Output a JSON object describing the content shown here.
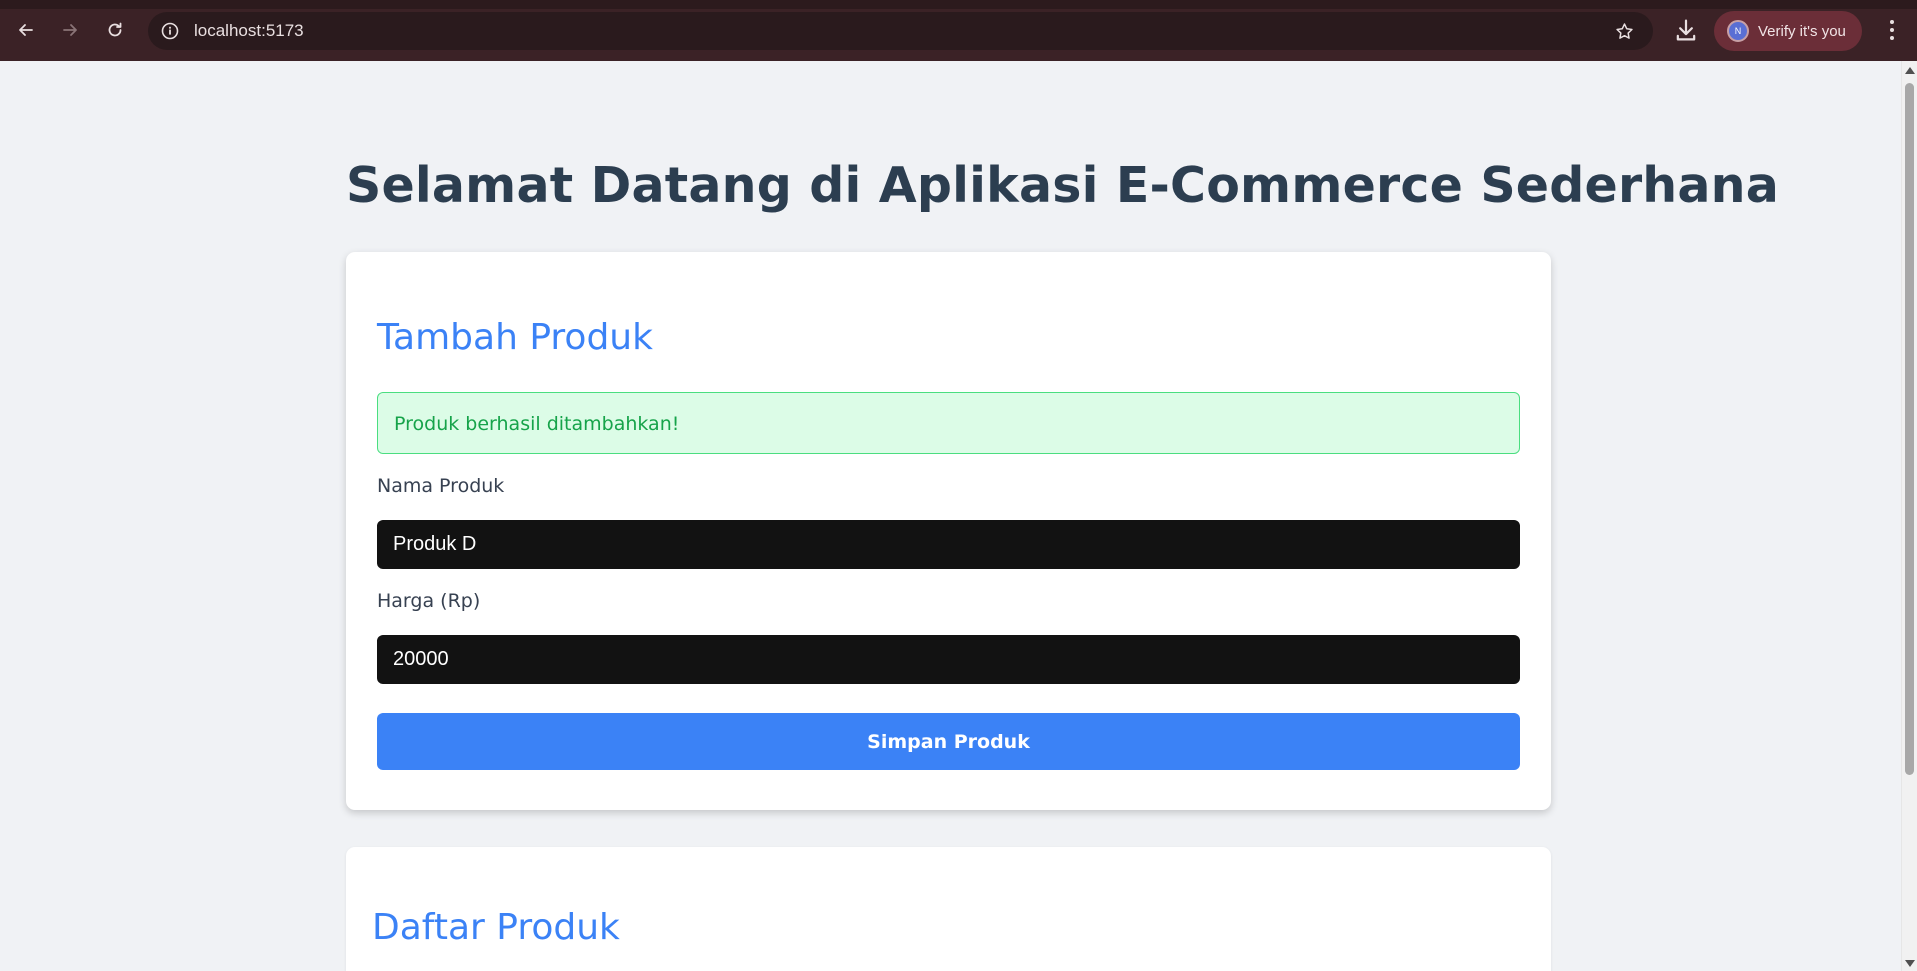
{
  "browser": {
    "url": "localhost:5173",
    "verify_label": "Verify it's you",
    "avatar_initial": "N",
    "icons": [
      "back-icon",
      "forward-icon",
      "reload-icon",
      "site-info-icon",
      "bookmark-star-icon",
      "download-icon",
      "kebab-menu-icon"
    ]
  },
  "page": {
    "title": "Selamat Datang di Aplikasi E-Commerce Sederhana"
  },
  "add_product": {
    "heading": "Tambah Produk",
    "success_message": "Produk berhasil ditambahkan!",
    "name_label": "Nama Produk",
    "name_value": "Produk D",
    "price_label": "Harga (Rp)",
    "price_value": "20000",
    "submit_label": "Simpan Produk"
  },
  "product_list": {
    "heading": "Daftar Produk"
  },
  "colors": {
    "accent": "#3b82f6",
    "success_bg": "#dcfce7",
    "success_text": "#16a34a",
    "title": "#2c3e50",
    "chrome": "#3b2226"
  }
}
